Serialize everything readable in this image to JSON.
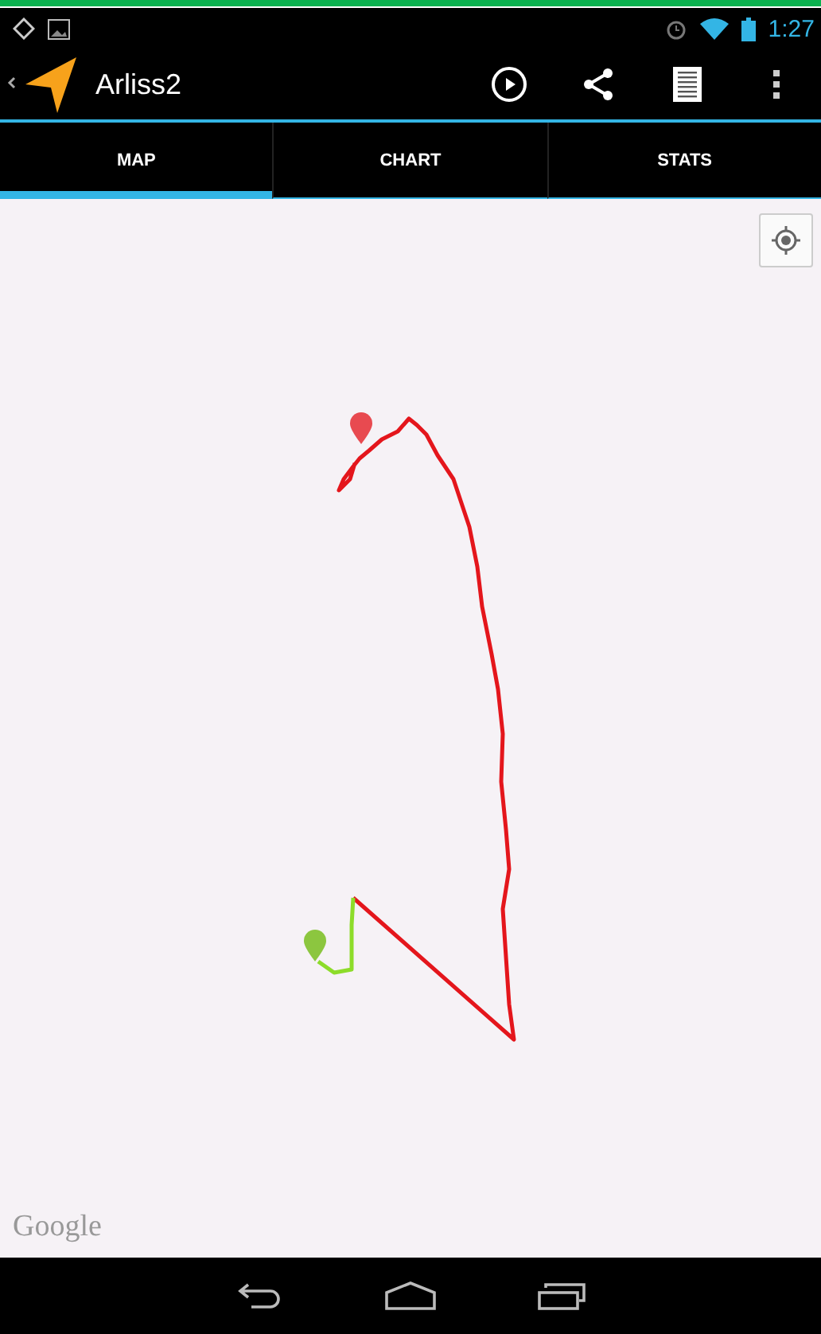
{
  "status_bar": {
    "time": "1:27"
  },
  "action_bar": {
    "title": "Arliss2"
  },
  "tabs": [
    {
      "label": "MAP",
      "selected": true
    },
    {
      "label": "CHART",
      "selected": false
    },
    {
      "label": "STATS",
      "selected": false
    }
  ],
  "map": {
    "attribution": "Google"
  }
}
